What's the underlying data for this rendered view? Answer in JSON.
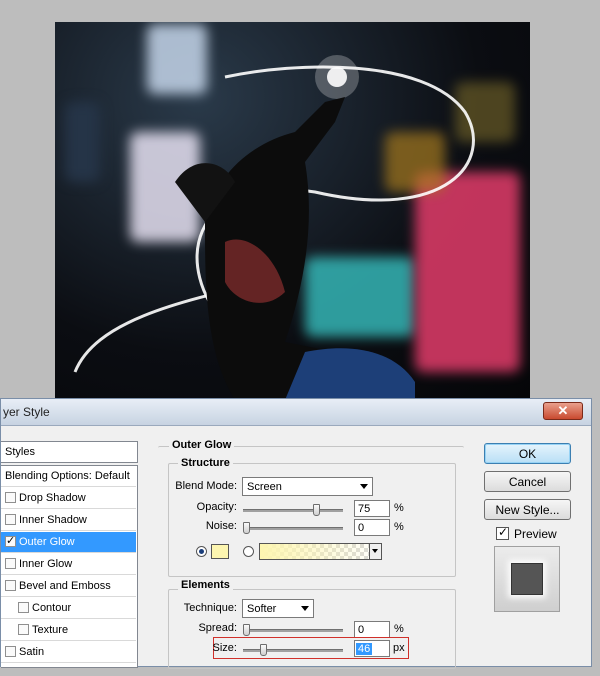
{
  "dialog": {
    "title": "yer Style"
  },
  "styles_list": {
    "header": "Styles",
    "items": [
      {
        "label": "Blending Options: Default",
        "checkbox": false,
        "checked": false,
        "sub": false,
        "active": false
      },
      {
        "label": "Drop Shadow",
        "checkbox": true,
        "checked": false,
        "sub": false,
        "active": false
      },
      {
        "label": "Inner Shadow",
        "checkbox": true,
        "checked": false,
        "sub": false,
        "active": false
      },
      {
        "label": "Outer Glow",
        "checkbox": true,
        "checked": true,
        "sub": false,
        "active": true
      },
      {
        "label": "Inner Glow",
        "checkbox": true,
        "checked": false,
        "sub": false,
        "active": false
      },
      {
        "label": "Bevel and Emboss",
        "checkbox": true,
        "checked": false,
        "sub": false,
        "active": false
      },
      {
        "label": "Contour",
        "checkbox": true,
        "checked": false,
        "sub": true,
        "active": false
      },
      {
        "label": "Texture",
        "checkbox": true,
        "checked": false,
        "sub": true,
        "active": false
      },
      {
        "label": "Satin",
        "checkbox": true,
        "checked": false,
        "sub": false,
        "active": false
      }
    ]
  },
  "outer_glow": {
    "title": "Outer Glow",
    "structure": {
      "title": "Structure",
      "blend_mode_label": "Blend Mode:",
      "blend_mode_value": "Screen",
      "opacity_label": "Opacity:",
      "opacity_value": "75",
      "opacity_unit": "%",
      "opacity_level": 0.75,
      "noise_label": "Noise:",
      "noise_value": "0",
      "noise_unit": "%",
      "noise_level": 0,
      "color_mode": "solid",
      "glow_color": "#fdf6b0"
    },
    "elements": {
      "title": "Elements",
      "technique_label": "Technique:",
      "technique_value": "Softer",
      "spread_label": "Spread:",
      "spread_value": "0",
      "spread_unit": "%",
      "spread_level": 0,
      "size_label": "Size:",
      "size_value": "46",
      "size_unit": "px",
      "size_level": 0.18
    }
  },
  "buttons": {
    "ok": "OK",
    "cancel": "Cancel",
    "new_style": "New Style...",
    "preview_label": "Preview",
    "preview_checked": true
  },
  "colors": {
    "accent": "#3399ff",
    "highlight_border": "#d0302a"
  }
}
